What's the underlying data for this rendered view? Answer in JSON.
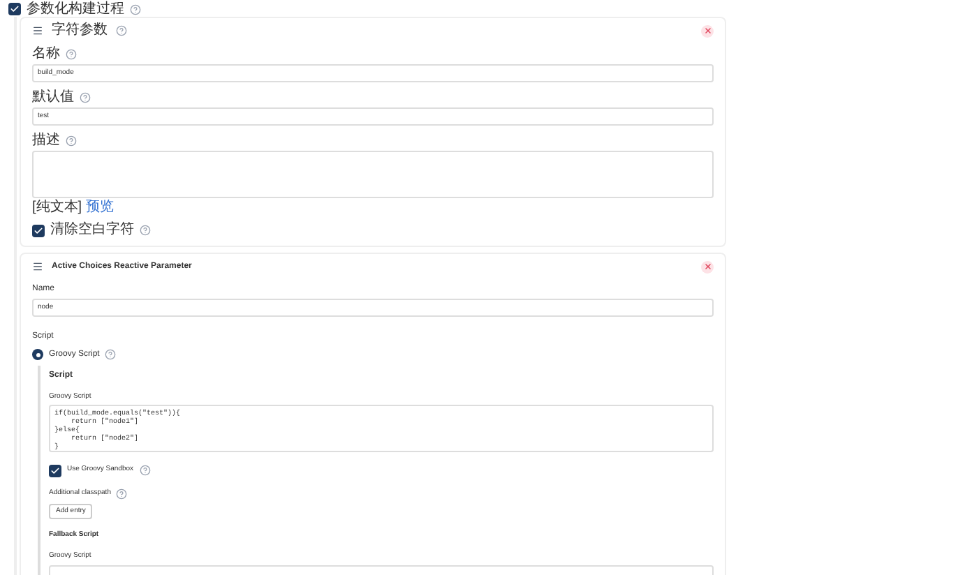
{
  "build_parameterized": {
    "label": "参数化构建过程",
    "checked": true
  },
  "string_parameter": {
    "title": "字符参数",
    "fields": [
      {
        "kind": "input",
        "label": "名称",
        "value": "build_mode"
      },
      {
        "kind": "input",
        "label": "默认值",
        "value": "test"
      },
      {
        "kind": "textarea",
        "label": "描述"
      }
    ],
    "format_note": "[纯文本]",
    "preview_link": "预览",
    "trim": {
      "label": "清除空白字符",
      "checked": true
    }
  },
  "active_choices_parameter": {
    "title": "Active Choices Reactive Parameter",
    "name_label": "Name",
    "name_value": "node",
    "script_label": "Script",
    "script_option": {
      "label": "Groovy Script",
      "selected": true
    },
    "script_section": {
      "heading": "Script",
      "groovy_label": "Groovy Script",
      "code": "if(build_mode.equals(\"test\")){\n    return [\"node1\"]\n}else{\n    return [\"node2\"]\n}",
      "sandbox": {
        "label": "Use Groovy Sandbox",
        "checked": true
      },
      "classpath_label": "Additional classpath",
      "add_button": "Add entry",
      "fallback_heading": "Fallback Script",
      "fallback_groovy_label": "Groovy Script"
    }
  }
}
